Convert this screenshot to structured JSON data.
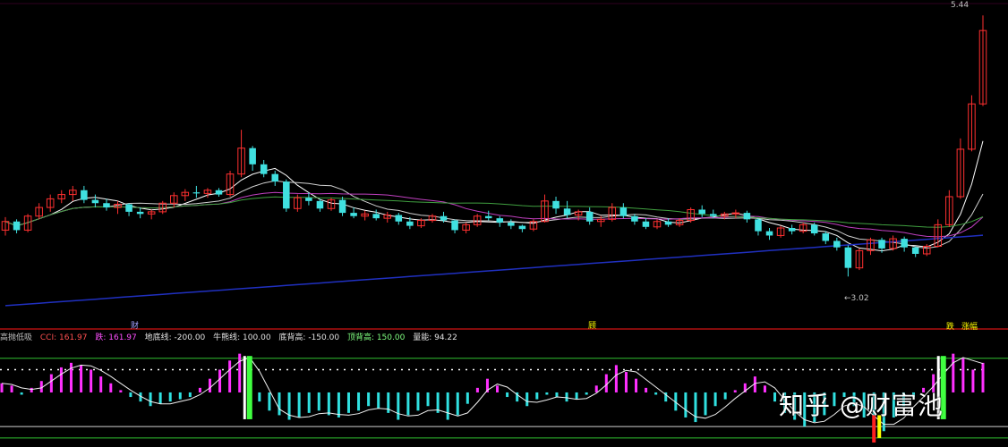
{
  "chart_data": [
    {
      "type": "candlestick",
      "panel": "price",
      "price_high_label": "5.44",
      "price_low_label": "←3.02",
      "ylim": [
        2.6,
        5.5
      ],
      "candles": [
        [
          3.45,
          3.57,
          3.4,
          3.53
        ],
        [
          3.53,
          3.55,
          3.42,
          3.45
        ],
        [
          3.45,
          3.6,
          3.43,
          3.58
        ],
        [
          3.58,
          3.7,
          3.55,
          3.66
        ],
        [
          3.66,
          3.78,
          3.62,
          3.74
        ],
        [
          3.74,
          3.82,
          3.7,
          3.78
        ],
        [
          3.78,
          3.86,
          3.72,
          3.82
        ],
        [
          3.82,
          3.86,
          3.7,
          3.73
        ],
        [
          3.73,
          3.78,
          3.66,
          3.7
        ],
        [
          3.7,
          3.74,
          3.63,
          3.66
        ],
        [
          3.66,
          3.72,
          3.6,
          3.69
        ],
        [
          3.69,
          3.7,
          3.58,
          3.62
        ],
        [
          3.62,
          3.66,
          3.56,
          3.6
        ],
        [
          3.6,
          3.64,
          3.55,
          3.62
        ],
        [
          3.62,
          3.72,
          3.6,
          3.7
        ],
        [
          3.7,
          3.8,
          3.66,
          3.77
        ],
        [
          3.77,
          3.83,
          3.72,
          3.8
        ],
        [
          3.8,
          3.86,
          3.75,
          3.79
        ],
        [
          3.79,
          3.84,
          3.75,
          3.82
        ],
        [
          3.82,
          3.84,
          3.76,
          3.78
        ],
        [
          3.78,
          4.0,
          3.76,
          3.97
        ],
        [
          3.97,
          4.38,
          3.94,
          4.21
        ],
        [
          4.21,
          4.23,
          4.0,
          4.06
        ],
        [
          4.06,
          4.1,
          3.94,
          3.97
        ],
        [
          3.97,
          4.0,
          3.86,
          3.9
        ],
        [
          3.9,
          3.92,
          3.62,
          3.65
        ],
        [
          3.65,
          3.78,
          3.62,
          3.75
        ],
        [
          3.75,
          3.8,
          3.68,
          3.72
        ],
        [
          3.72,
          3.74,
          3.62,
          3.65
        ],
        [
          3.65,
          3.75,
          3.63,
          3.73
        ],
        [
          3.73,
          3.76,
          3.58,
          3.61
        ],
        [
          3.61,
          3.66,
          3.56,
          3.58
        ],
        [
          3.58,
          3.63,
          3.54,
          3.6
        ],
        [
          3.6,
          3.64,
          3.54,
          3.56
        ],
        [
          3.56,
          3.62,
          3.52,
          3.59
        ],
        [
          3.59,
          3.61,
          3.5,
          3.53
        ],
        [
          3.53,
          3.57,
          3.46,
          3.49
        ],
        [
          3.49,
          3.56,
          3.47,
          3.54
        ],
        [
          3.54,
          3.6,
          3.52,
          3.58
        ],
        [
          3.58,
          3.62,
          3.52,
          3.54
        ],
        [
          3.54,
          3.55,
          3.42,
          3.45
        ],
        [
          3.45,
          3.52,
          3.42,
          3.5
        ],
        [
          3.5,
          3.6,
          3.48,
          3.58
        ],
        [
          3.58,
          3.63,
          3.54,
          3.56
        ],
        [
          3.56,
          3.58,
          3.48,
          3.52
        ],
        [
          3.52,
          3.55,
          3.46,
          3.49
        ],
        [
          3.49,
          3.5,
          3.43,
          3.46
        ],
        [
          3.46,
          3.55,
          3.44,
          3.53
        ],
        [
          3.53,
          3.78,
          3.52,
          3.72
        ],
        [
          3.72,
          3.76,
          3.6,
          3.65
        ],
        [
          3.65,
          3.72,
          3.56,
          3.59
        ],
        [
          3.59,
          3.64,
          3.54,
          3.62
        ],
        [
          3.62,
          3.66,
          3.5,
          3.53
        ],
        [
          3.53,
          3.58,
          3.48,
          3.55
        ],
        [
          3.55,
          3.7,
          3.53,
          3.66
        ],
        [
          3.66,
          3.7,
          3.56,
          3.58
        ],
        [
          3.58,
          3.6,
          3.5,
          3.53
        ],
        [
          3.53,
          3.56,
          3.46,
          3.48
        ],
        [
          3.48,
          3.55,
          3.46,
          3.53
        ],
        [
          3.53,
          3.56,
          3.48,
          3.5
        ],
        [
          3.5,
          3.56,
          3.48,
          3.54
        ],
        [
          3.54,
          3.66,
          3.52,
          3.64
        ],
        [
          3.64,
          3.68,
          3.57,
          3.6
        ],
        [
          3.6,
          3.64,
          3.56,
          3.58
        ],
        [
          3.58,
          3.62,
          3.55,
          3.6
        ],
        [
          3.6,
          3.64,
          3.56,
          3.61
        ],
        [
          3.61,
          3.63,
          3.52,
          3.55
        ],
        [
          3.55,
          3.56,
          3.4,
          3.44
        ],
        [
          3.44,
          3.47,
          3.36,
          3.4
        ],
        [
          3.4,
          3.49,
          3.38,
          3.47
        ],
        [
          3.47,
          3.5,
          3.41,
          3.44
        ],
        [
          3.44,
          3.52,
          3.42,
          3.5
        ],
        [
          3.5,
          3.52,
          3.4,
          3.42
        ],
        [
          3.42,
          3.44,
          3.32,
          3.35
        ],
        [
          3.35,
          3.38,
          3.26,
          3.29
        ],
        [
          3.29,
          3.31,
          3.02,
          3.1
        ],
        [
          3.1,
          3.28,
          3.08,
          3.26
        ],
        [
          3.26,
          3.38,
          3.22,
          3.36
        ],
        [
          3.36,
          3.38,
          3.24,
          3.28
        ],
        [
          3.28,
          3.4,
          3.26,
          3.37
        ],
        [
          3.37,
          3.39,
          3.25,
          3.29
        ],
        [
          3.29,
          3.3,
          3.2,
          3.23
        ],
        [
          3.23,
          3.32,
          3.21,
          3.3
        ],
        [
          3.3,
          3.55,
          3.29,
          3.5
        ],
        [
          3.5,
          3.82,
          3.48,
          3.76
        ],
        [
          3.76,
          4.3,
          3.74,
          4.2
        ],
        [
          4.2,
          4.7,
          4.18,
          4.62
        ],
        [
          4.62,
          5.44,
          4.6,
          5.3
        ]
      ]
    },
    {
      "type": "bar",
      "panel": "indicator",
      "indicator_name": "高抛低吸",
      "cci_label": "CCI: 161.97",
      "die_label": "跌: 161.97",
      "floor_label": "地底线: -200.00",
      "bull_label": "牛熊线: 100.00",
      "bottom_div_label": "底背高: -150.00",
      "top_div_label": "顶背高: 150.00",
      "energy_label": "量能: 94.22",
      "ylim": [
        -220,
        200
      ],
      "signal_marks": [
        {
          "label": "财",
          "color": "#a0a0ff"
        },
        {
          "label": "顾",
          "color": "#ffff00"
        },
        {
          "label": "跌",
          "color": "#ffff00"
        },
        {
          "label": "涨幅",
          "color": "#ffff00"
        }
      ],
      "values": [
        40,
        30,
        -10,
        20,
        50,
        80,
        110,
        130,
        120,
        100,
        70,
        40,
        10,
        -20,
        -40,
        -60,
        -50,
        -40,
        -30,
        -20,
        20,
        60,
        100,
        140,
        170,
        150,
        -40,
        -80,
        -100,
        -120,
        -110,
        -90,
        -80,
        -100,
        -110,
        -90,
        -80,
        -60,
        -70,
        -90,
        -120,
        -100,
        -80,
        -60,
        -90,
        -120,
        -100,
        -50,
        20,
        60,
        30,
        -20,
        -40,
        -60,
        -30,
        -10,
        -20,
        -40,
        -30,
        -10,
        30,
        80,
        120,
        90,
        60,
        20,
        -10,
        -40,
        -80,
        -110,
        -130,
        -100,
        -60,
        -30,
        10,
        40,
        70,
        30,
        -40,
        -90,
        -120,
        -150,
        -130,
        -100,
        -60,
        -20,
        -60,
        -110,
        -140,
        -170,
        -110,
        -60,
        -20,
        20,
        80,
        140,
        170,
        150,
        100,
        130
      ]
    }
  ],
  "watermark": "知乎 @财富池"
}
